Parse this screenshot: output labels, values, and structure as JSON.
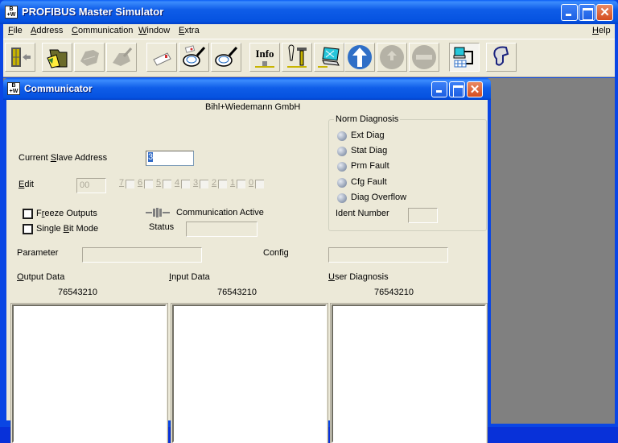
{
  "window": {
    "title": "PROFIBUS Master Simulator",
    "icon": "bw-logo-icon",
    "controls": [
      "minimize",
      "maximize",
      "close"
    ]
  },
  "menubar": {
    "items": [
      {
        "label": "File",
        "mnemonic": "F"
      },
      {
        "label": "Address",
        "mnemonic": "A"
      },
      {
        "label": "Communication",
        "mnemonic": "C"
      },
      {
        "label": "Window",
        "mnemonic": "W"
      },
      {
        "label": "Extra",
        "mnemonic": "E"
      }
    ],
    "help": {
      "label": "Help",
      "mnemonic": "H"
    }
  },
  "toolbar": {
    "buttons": [
      {
        "icon": "exit-door-icon",
        "enabled": true
      },
      {
        "icon": "open-folder-icon",
        "enabled": true
      },
      {
        "icon": "map-icon",
        "enabled": false
      },
      {
        "icon": "edit-map-icon",
        "enabled": false
      },
      {
        "icon": "envelope-icon",
        "enabled": true
      },
      {
        "icon": "search-diagnosis-icon",
        "enabled": true
      },
      {
        "icon": "magnifier-icon",
        "enabled": true
      },
      {
        "icon": "info-icon",
        "label": "Info",
        "enabled": true
      },
      {
        "icon": "tools-icon",
        "enabled": true
      },
      {
        "icon": "monitor-icon",
        "enabled": true
      },
      {
        "icon": "arrow-up-icon",
        "enabled": true
      },
      {
        "icon": "arrow-up-small-icon",
        "enabled": false
      },
      {
        "icon": "stop-icon",
        "enabled": false
      },
      {
        "icon": "network-icon",
        "enabled": true,
        "pressed": true
      },
      {
        "icon": "help-head-icon",
        "enabled": true
      }
    ]
  },
  "communicator": {
    "title": "Communicator",
    "company": "Bihl+Wiedemann GmbH",
    "current_slave_address": {
      "label": "Current Slave Address",
      "mnemonic": "S",
      "value": "3"
    },
    "edit": {
      "label": "Edit",
      "mnemonic": "E",
      "value": "00",
      "bits": [
        "7",
        "6",
        "5",
        "4",
        "3",
        "2",
        "1",
        "0"
      ]
    },
    "freeze_outputs": {
      "label": "Freeze Outputs",
      "checked": false
    },
    "single_bit_mode": {
      "label": "Single Bit Mode",
      "checked": false
    },
    "communication_active": {
      "label": "Communication Active"
    },
    "status": {
      "label": "Status",
      "value": ""
    },
    "norm_diagnosis": {
      "title": "Norm Diagnosis",
      "items": [
        "Ext Diag",
        "Stat Diag",
        "Prm Fault",
        "Cfg Fault",
        "Diag Overflow"
      ],
      "ident_number": {
        "label": "Ident Number",
        "value": ""
      }
    },
    "parameter": {
      "label": "Parameter",
      "value": ""
    },
    "config": {
      "label": "Config",
      "value": ""
    },
    "output_data": {
      "label": "Output Data",
      "bits_header": "76543210"
    },
    "input_data": {
      "label": "Input Data",
      "bits_header": "76543210"
    },
    "user_diagnosis": {
      "label": "User Diagnosis",
      "bits_header": "76543210"
    }
  }
}
